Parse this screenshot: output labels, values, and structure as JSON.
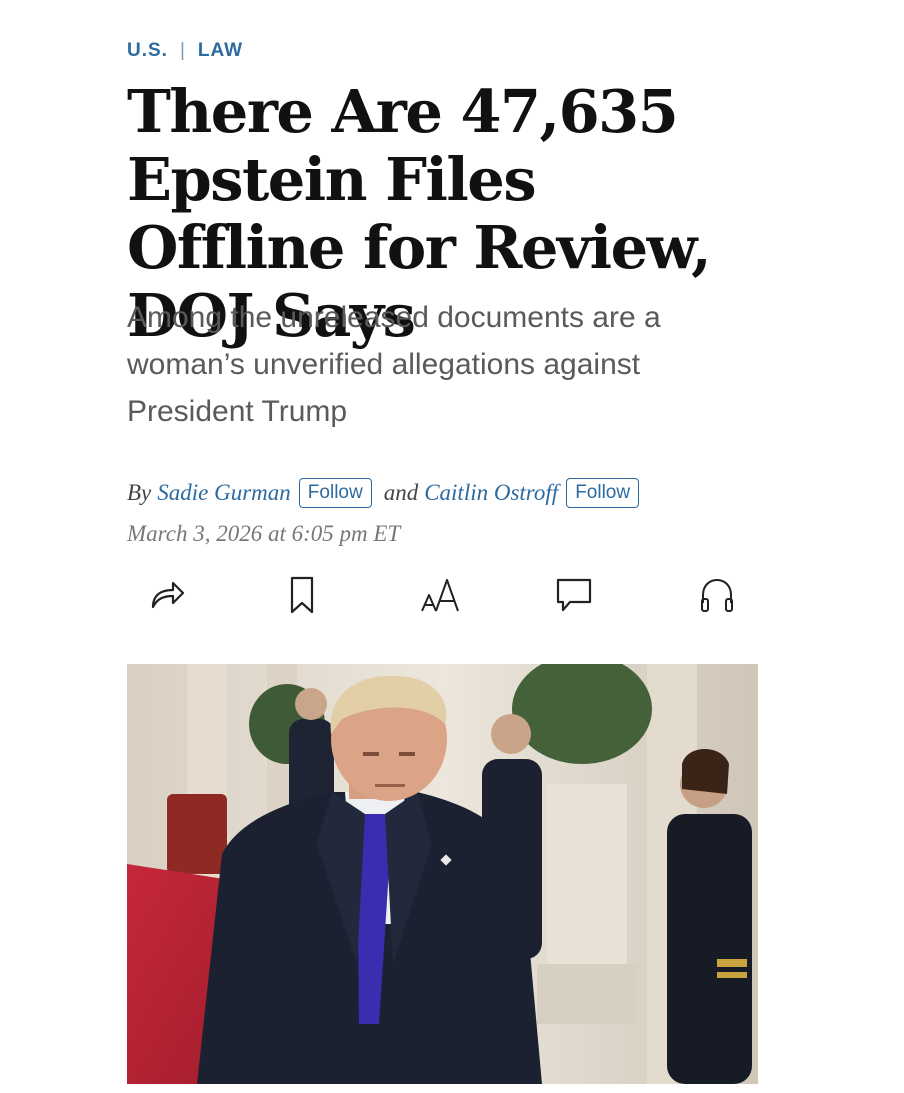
{
  "breadcrumb": {
    "section": "U.S.",
    "separator": "|",
    "subsection": "LAW"
  },
  "headline": "There Are 47,635 Epstein Files Offline for Review, DOJ Says",
  "dek": "Among the unreleased documents are a woman’s unverified allegations against President Trump",
  "byline": {
    "by": "By",
    "author1": "Sadie Gurman",
    "and": "and",
    "author2": "Caitlin Ostroff",
    "follow_label": "Follow"
  },
  "dateline": "March 3, 2026 at 6:05 pm ET",
  "toolbar": {
    "icons": [
      "share-icon",
      "bookmark-icon",
      "text-size-icon",
      "comment-icon",
      "listen-icon"
    ],
    "text_size_glyph": "AA"
  },
  "colors": {
    "accent": "#2c6aa0",
    "headline": "#111111",
    "dek": "#5a5a5a",
    "meta": "#777777"
  }
}
